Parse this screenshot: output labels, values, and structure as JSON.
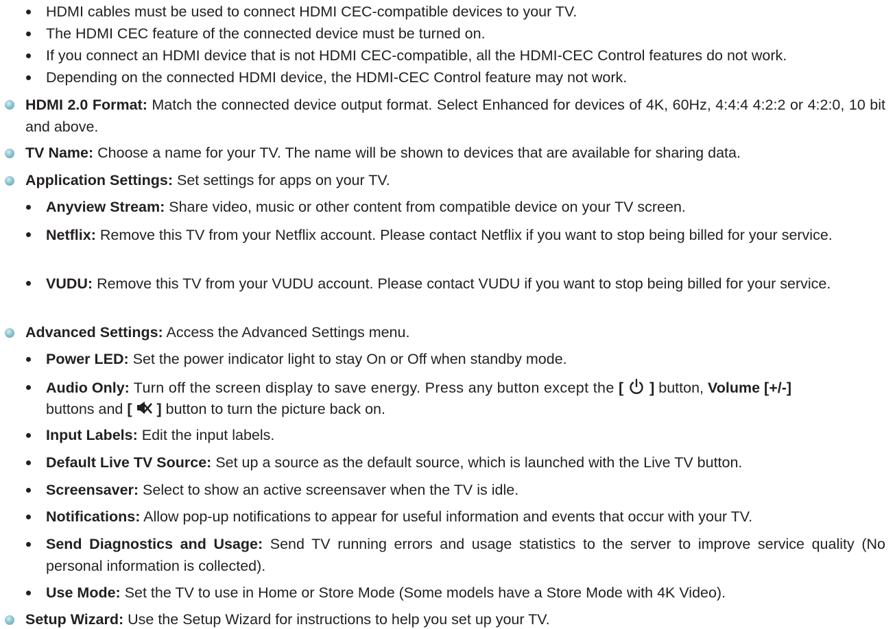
{
  "cec_notes": [
    "HDMI cables must be used to connect HDMI CEC-compatible devices to your TV.",
    "The HDMI CEC feature of the connected device must be turned on.",
    "If you connect an HDMI device that is not HDMI CEC-compatible, all the HDMI-CEC Control features do not work.",
    "Depending on the connected HDMI device, the HDMI-CEC Control feature may not work."
  ],
  "hdmi_format": {
    "term": "HDMI 2.0 Format:",
    "desc": " Match the connected device output format. Select Enhanced for devices of 4K, 60Hz, 4:4:4 4:2:2 or 4:2:0, 10 bit and above."
  },
  "tv_name": {
    "term": "TV Name:",
    "desc": " Choose a name for your TV. The name will be shown to devices that are available for sharing data."
  },
  "app_settings": {
    "term": "Application Settings:",
    "desc": " Set settings for apps on your TV.",
    "items": [
      {
        "term": "Anyview Stream:",
        "desc": " Share video, music or other content from compatible device on your TV screen."
      },
      {
        "term": "Netflix:",
        "desc": " Remove this TV from your Netflix account. Please contact Netflix if you want to stop being billed for your service."
      },
      {
        "term": "VUDU:",
        "desc": " Remove this TV from your VUDU account. Please contact VUDU if you want to stop being billed for your service."
      }
    ]
  },
  "advanced": {
    "term": "Advanced Settings:",
    "desc": " Access the Advanced Settings menu.",
    "power_led": {
      "term": "Power LED:",
      "desc": " Set the power indicator light to stay On or Off when standby mode."
    },
    "audio_only": {
      "term": "Audio Only:",
      "desc_a": " Turn off the screen display to save energy. Press any button except the ",
      "bracket_open": "[",
      "bracket_close": "]",
      "desc_b": " button, ",
      "volume": "Volume [+/-]",
      "desc_c": " buttons and ",
      "desc_d": " button to turn the picture back on.",
      "power_icon": "power-icon",
      "mute_icon": "mute-icon"
    },
    "items": [
      {
        "term": "Input Labels:",
        "desc": " Edit the input labels."
      },
      {
        "term": "Default Live TV Source:",
        "desc": " Set up a source as the default source, which is launched with the Live TV button."
      },
      {
        "term": "Screensaver:",
        "desc": " Select to show an active screensaver when the TV is idle."
      },
      {
        "term": "Notifications:",
        "desc": " Allow pop-up notifications to appear for useful information and events that occur with your TV."
      }
    ],
    "diagnostics": {
      "term": "Send Diagnostics and Usage:",
      "desc": " Send TV running errors and usage statistics to the server to improve service quality (No personal information is collected)."
    },
    "use_mode": {
      "term": "Use Mode:",
      "desc": " Set the TV to use in Home or Store Mode (Some models have a Store Mode with 4K Video)."
    }
  },
  "setup_wizard": {
    "term": "Setup Wizard:",
    "desc": " Use the Setup Wizard for instructions to help you set up your TV."
  }
}
